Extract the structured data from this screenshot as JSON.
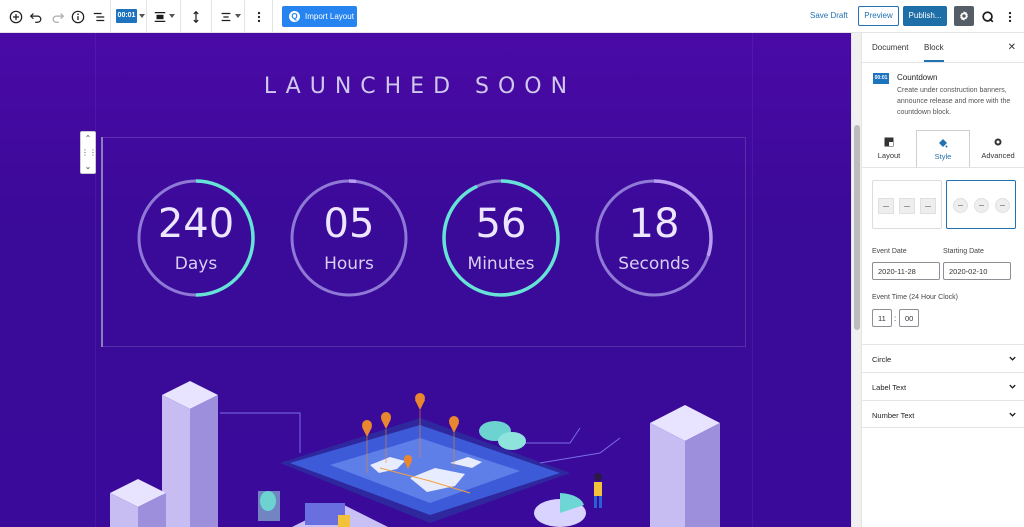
{
  "toolbar": {
    "block_chip": "00:01",
    "import_label": "Import Layout",
    "save_draft": "Save Draft",
    "preview": "Preview",
    "publish": "Publish..."
  },
  "canvas": {
    "title": "LAUNCHED SOON",
    "countdown": [
      {
        "number": "240",
        "label": "Days",
        "progress": 0.5,
        "accent": "#66e3d6"
      },
      {
        "number": "05",
        "label": "Hours",
        "progress": 0.02,
        "accent": "#b79cf0"
      },
      {
        "number": "56",
        "label": "Minutes",
        "progress": 0.93,
        "accent": "#66e3d6"
      },
      {
        "number": "18",
        "label": "Seconds",
        "progress": 0.3,
        "accent": "#b79cf0"
      }
    ],
    "colors": {
      "background": "#3f0aa0",
      "ring": "#8f79d6",
      "accent": "#66e3d6"
    }
  },
  "sidebar": {
    "tabs": {
      "document": "Document",
      "block": "Block"
    },
    "block_icon": "00:01",
    "block_title": "Countdown",
    "block_desc": "Create under construction banners, announce release and more with the countdown block.",
    "style_tabs": {
      "layout": "Layout",
      "style": "Style",
      "advanced": "Advanced"
    },
    "event_date_label": "Event Date",
    "event_date": "2020-11-28",
    "starting_date_label": "Starting Date",
    "starting_date": "2020-02-10",
    "event_time_label": "Event Time (24 Hour Clock)",
    "hour": "11",
    "minute": "00",
    "colon": ":",
    "panels": {
      "circle": "Circle",
      "label_text": "Label Text",
      "number_text": "Number Text"
    }
  }
}
